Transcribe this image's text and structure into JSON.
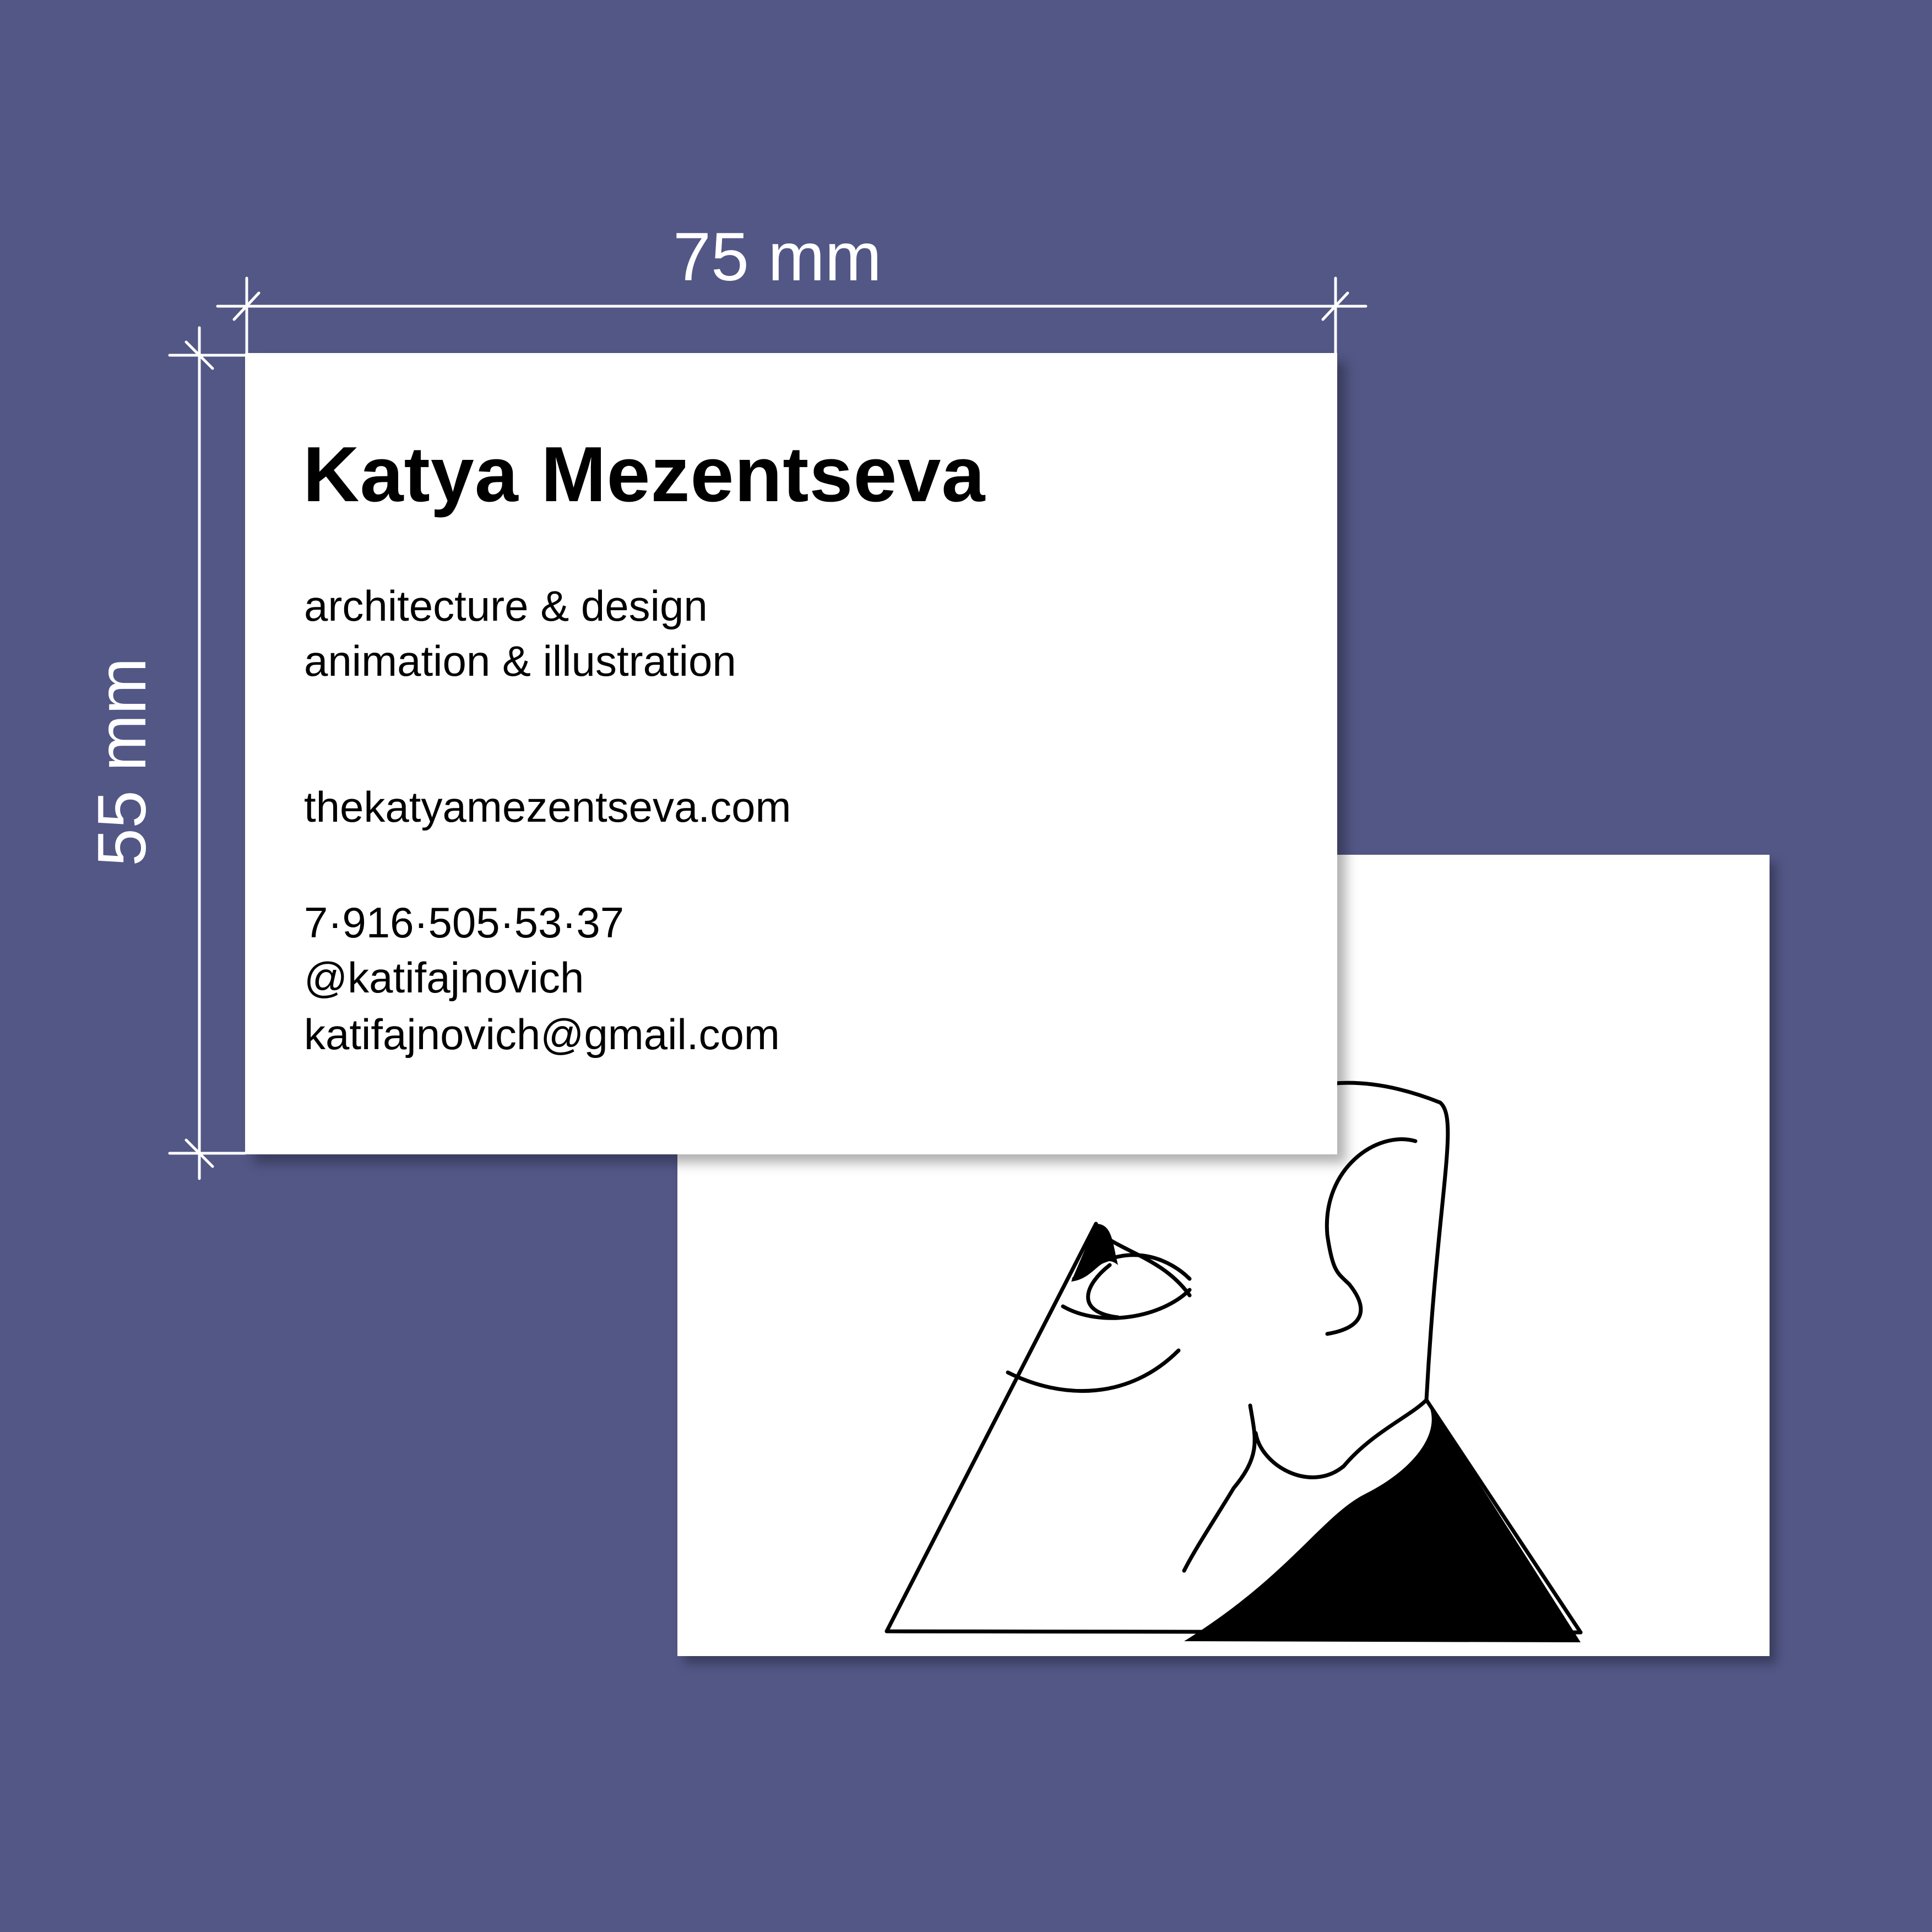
{
  "dimensions": {
    "width_label": "75 mm",
    "height_label": "55 mm"
  },
  "card_front": {
    "name": "Katya Mezentseva",
    "services": [
      "architecture & design",
      "animation & illustration"
    ],
    "website": "thekatyamezentseva.com",
    "phone": "7·916·505·53·37",
    "handle": "@katifajnovich",
    "email": "katifajnovich@gmail.com"
  },
  "card_back": {
    "illustration": "pyramid-eye-ear-illustration"
  },
  "colors": {
    "background": "#525786",
    "card": "#ffffff",
    "ink": "#000000",
    "annotation": "#ffffff"
  }
}
